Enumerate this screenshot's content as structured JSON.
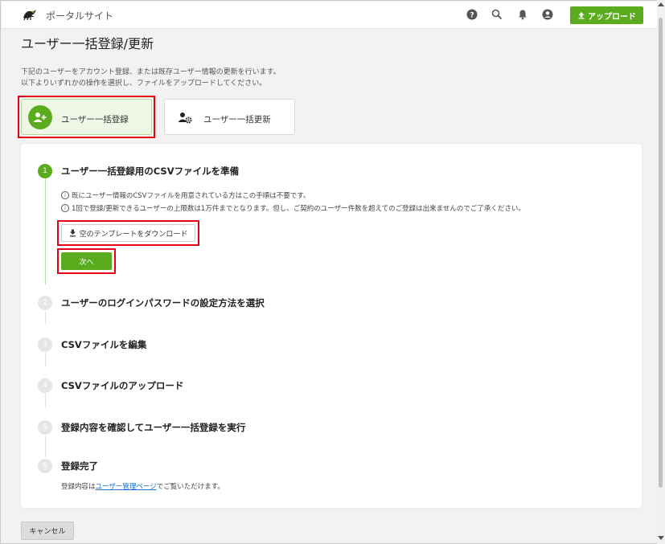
{
  "header": {
    "site_name": "ポータルサイト",
    "upload_label": "アップロード",
    "icons": [
      "help-icon",
      "search-icon",
      "bell-icon",
      "account-icon",
      "upload-icon"
    ]
  },
  "page": {
    "title": "ユーザー一括登録/更新",
    "description_line1": "下記のユーザーをアカウント登録、または既存ユーザー情報の更新を行います。",
    "description_line2": "以下よりいずれかの操作を選択し、ファイルをアップロードしてください。"
  },
  "modes": {
    "register_label": "ユーザー一括登録",
    "update_label": "ユーザー一括更新",
    "selected": "register"
  },
  "steps": [
    {
      "number": "1",
      "title": "ユーザー一括登録用のCSVファイルを準備"
    },
    {
      "number": "2",
      "title": "ユーザーのログインパスワードの設定方法を選択"
    },
    {
      "number": "3",
      "title": "CSVファイルを編集"
    },
    {
      "number": "4",
      "title": "CSVファイルのアップロード"
    },
    {
      "number": "5",
      "title": "登録内容を確認してユーザー一括登録を実行"
    },
    {
      "number": "6",
      "title": "登録完了"
    }
  ],
  "step1": {
    "note1": "既にユーザー情報のCSVファイルを用意されている方はこの手順は不要です。",
    "note2": "1回で登録/更新できるユーザーの上限数は1万件までとなります。但し、ご契約のユーザー件数を超えてのご登録は出来ませんのでご了承ください。",
    "template_button": "空のテンプレートをダウンロード",
    "next_button": "次へ"
  },
  "step6": {
    "note_before": "登録内容は",
    "note_link": "ユーザー管理ページ",
    "note_after": "でご覧いただけます。"
  },
  "footer": {
    "cancel_label": "キャンセル"
  },
  "colors": {
    "accent": "#5aab1e",
    "highlight": "#e60012",
    "link": "#1a6dd0"
  }
}
